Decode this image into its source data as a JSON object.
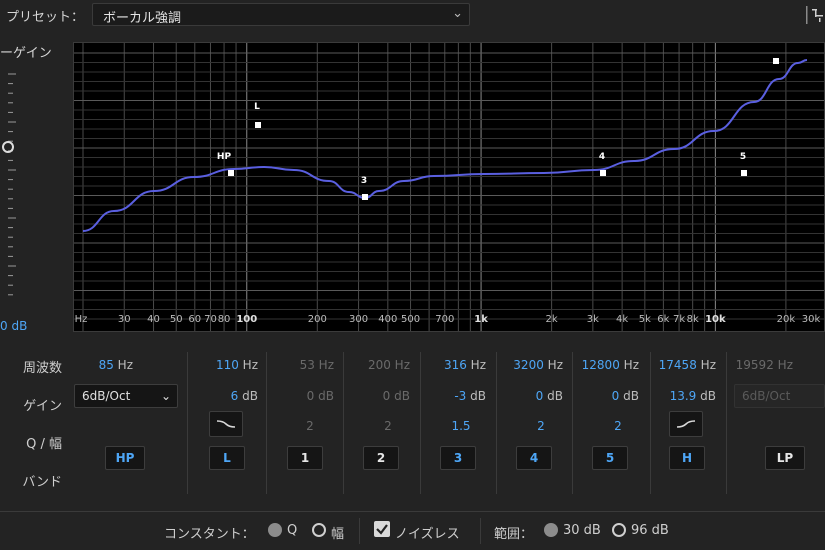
{
  "preset": {
    "label": "プリセット：",
    "value": "ボーカル強調"
  },
  "master_gain": {
    "label": "ーゲイン",
    "readout": "0 dB"
  },
  "graph": {
    "freq_labels": [
      "Hz",
      "30",
      "40",
      "50",
      "60",
      "70",
      "80",
      "100",
      "200",
      "300",
      "400",
      "500",
      "700",
      "1k",
      "2k",
      "3k",
      "4k",
      "5k",
      "6k",
      "7k",
      "8k",
      "10k",
      "20k",
      "30k"
    ],
    "markers": [
      "HP",
      "L",
      "3",
      "4",
      "5"
    ]
  },
  "row_labels": {
    "freq": "周波数",
    "gain": "ゲイン",
    "q": "Q / 幅",
    "band": "バンド"
  },
  "bands": [
    {
      "freq": "85",
      "freq_unit": "Hz",
      "slope": "6dB/Oct",
      "button": "HP",
      "active": true
    },
    {
      "freq": "110",
      "freq_unit": "Hz",
      "gain": "6",
      "gain_unit": "dB",
      "button": "L",
      "active": true
    },
    {
      "freq": "53",
      "freq_unit": "Hz",
      "gain": "0",
      "gain_unit": "dB",
      "q": "2",
      "button": "1",
      "active": false
    },
    {
      "freq": "200",
      "freq_unit": "Hz",
      "gain": "0",
      "gain_unit": "dB",
      "q": "2",
      "button": "2",
      "active": false
    },
    {
      "freq": "316",
      "freq_unit": "Hz",
      "gain": "-3",
      "gain_unit": "dB",
      "q": "1.5",
      "button": "3",
      "active": true
    },
    {
      "freq": "3200",
      "freq_unit": "Hz",
      "gain": "0",
      "gain_unit": "dB",
      "q": "2",
      "button": "4",
      "active": true
    },
    {
      "freq": "12800",
      "freq_unit": "Hz",
      "gain": "0",
      "gain_unit": "dB",
      "q": "2",
      "button": "5",
      "active": true
    },
    {
      "freq": "17458",
      "freq_unit": "Hz",
      "gain": "13.9",
      "gain_unit": "dB",
      "button": "H",
      "active": true
    },
    {
      "freq": "19592",
      "freq_unit": "Hz",
      "slope": "6dB/Oct",
      "button": "LP",
      "active": false
    }
  ],
  "bottom": {
    "constant_label": "コンスタント：",
    "q_option": "Q",
    "width_option": "幅",
    "noiseless_label": "ノイズレス",
    "range_label": "範囲：",
    "range_30": "30 dB",
    "range_96": "96 dB"
  },
  "colors": {
    "accent": "#4ea6f6",
    "curve": "#5a5fe0",
    "background": "#232323"
  }
}
